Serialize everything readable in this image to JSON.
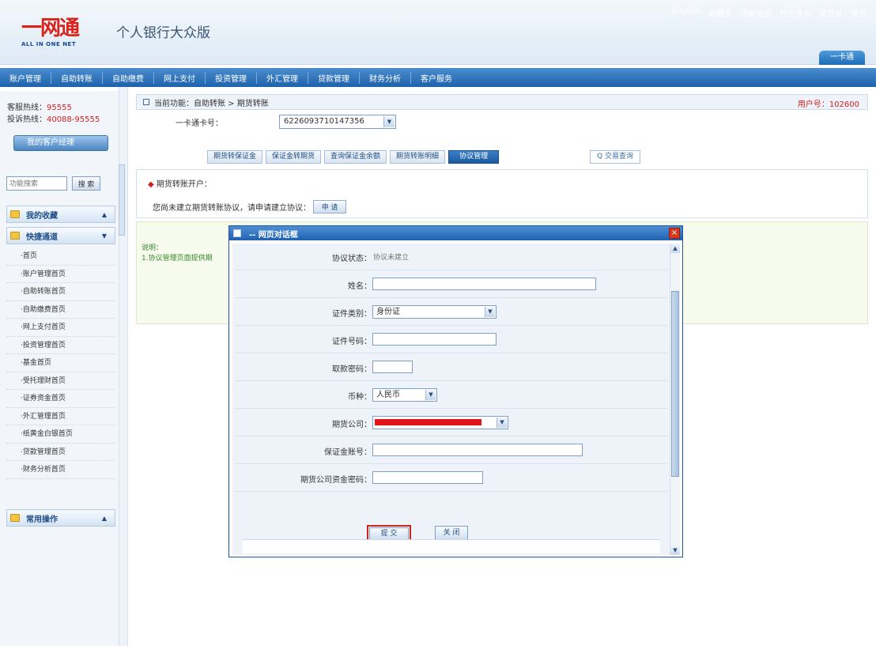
{
  "logo": {
    "mark": "一网通",
    "sub": "ALL IN ONE NET"
  },
  "app_title": "个人银行大众版",
  "top_links": [
    "English",
    "收藏页",
    "功能地图",
    "日志查询",
    "重登录",
    "退出"
  ],
  "top_tab": "一卡通",
  "nav_items": [
    "账户管理",
    "自助转账",
    "自助缴费",
    "网上支付",
    "投资管理",
    "外汇管理",
    "贷款管理",
    "财务分析",
    "客户服务"
  ],
  "sidebar": {
    "hotline": {
      "label": "客服热线：",
      "value": "95555"
    },
    "complaint": {
      "label": "投诉热线：",
      "value": "40088-95555"
    },
    "manager_button": "我的客户经理",
    "search_placeholder": "功能搜索",
    "search_button": "搜 索",
    "favorites": "我的收藏",
    "quick_channel": "快捷通道",
    "quick_items": [
      "·首页",
      "·账户管理首页",
      "·自助转账首页",
      "·自助缴费首页",
      "·网上支付首页",
      "·投资管理首页",
      "·基金首页",
      "·受托理财首页",
      "·证券资金首页",
      "·外汇管理首页",
      "·纸黄金白银首页",
      "·贷款管理首页",
      "·财务分析首页"
    ],
    "common_ops": "常用操作"
  },
  "main": {
    "breadcrumb": "当前功能：自助转账 > 期货转账",
    "user_no_label": "用户号：",
    "user_no": "102600",
    "card_label": "一卡通卡号：",
    "card_number": "6226093710147356",
    "tabs": [
      "期货转保证金",
      "保证金转期货",
      "查询保证金余额",
      "期货转账明细",
      "协议管理"
    ],
    "active_tab": "协议管理",
    "tx_query": "Q 交易查询",
    "section_title": "期货转账开户：",
    "apply_prompt": "您尚未建立期货转账协议，请申请建立协议：",
    "apply_button": "申 请",
    "notes_header": "说明：",
    "notes_line": "1.协议管理页面提供期"
  },
  "dialog": {
    "title": "-- 网页对话框",
    "status_label": "协议状态：",
    "status_value": "协议未建立",
    "name_label": "姓名：",
    "id_type_label": "证件类别：",
    "id_type_value": "身份证",
    "id_no_label": "证件号码：",
    "pwd_label": "取款密码：",
    "currency_label": "币种：",
    "currency_value": "人民币",
    "company_label": "期货公司：",
    "margin_acct_label": "保证金账号：",
    "fund_pwd_label": "期货公司资金密码：",
    "submit": "提 交",
    "close": "关 闭"
  }
}
